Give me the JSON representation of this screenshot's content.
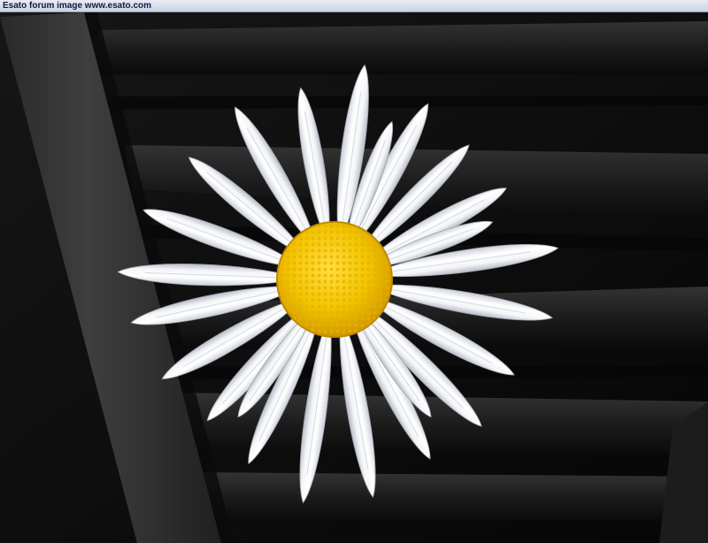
{
  "caption": {
    "text": "Esato forum image www.esato.com"
  },
  "photo": {
    "subject_icon": "daisy-flower",
    "colors": {
      "background": "#0c0c0c",
      "vent_slat": "#242424",
      "trim_bar": "#343434",
      "petal": "#f7f7f7",
      "petal_shadow": "#c9ced6",
      "disc": "#f2c400",
      "disc_edge": "#d29a00"
    }
  }
}
